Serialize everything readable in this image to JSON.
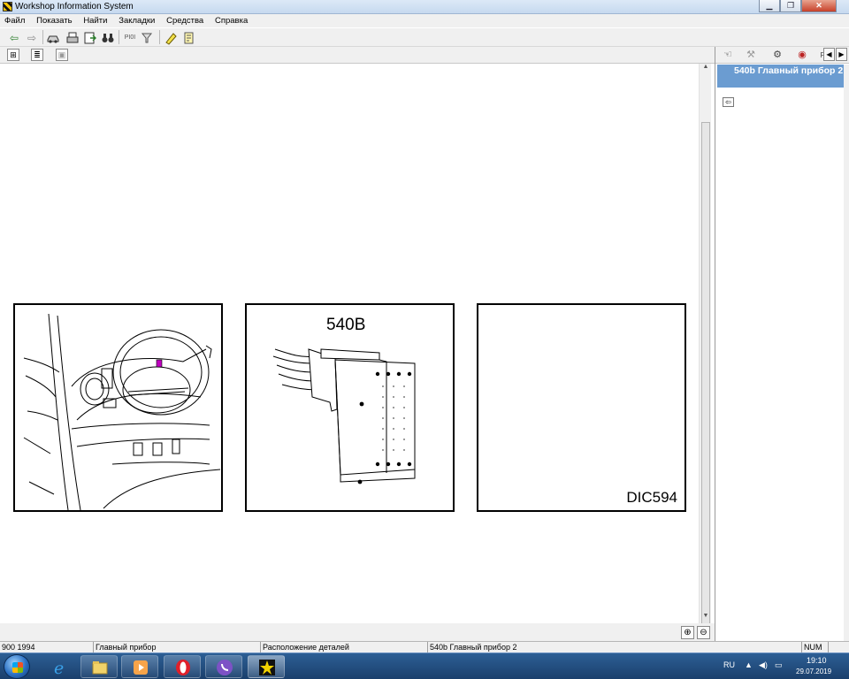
{
  "window": {
    "title": "Workshop Information System",
    "icon": "wis-app-icon",
    "controls": [
      "minimize",
      "maximize",
      "close"
    ]
  },
  "menu": {
    "items": [
      "Файл",
      "Показать",
      "Найти",
      "Закладки",
      "Средства",
      "Справка"
    ]
  },
  "toolbar": {
    "buttons": [
      "back-arrow-icon",
      "forward-arrow-icon",
      "car-icon",
      "printer-icon",
      "document-arrow-icon",
      "binoculars-icon",
      "pi-icon",
      "filter-icon",
      "highlighter-icon",
      "note-icon"
    ],
    "pi_label": "PI0I"
  },
  "figure": {
    "panel2_label": "540B",
    "panel3_label": "DIC594"
  },
  "side_panel": {
    "title": "540b Главный прибор 2",
    "icons": [
      "hand-icon",
      "wrench-icon",
      "gears-icon",
      "gauge-icon",
      "p-icon"
    ]
  },
  "status": {
    "model": "900 1994",
    "section": "Главный прибор",
    "view": "Расположение деталей",
    "item": "540b Главный прибор 2",
    "num": "NUM"
  },
  "taskbar": {
    "apps": [
      "ie-icon",
      "explorer-icon",
      "media-player-icon",
      "opera-icon",
      "viber-icon",
      "wis-taskbar-icon"
    ],
    "lang": "RU",
    "time": "19:10",
    "date": "29.07.2019"
  }
}
